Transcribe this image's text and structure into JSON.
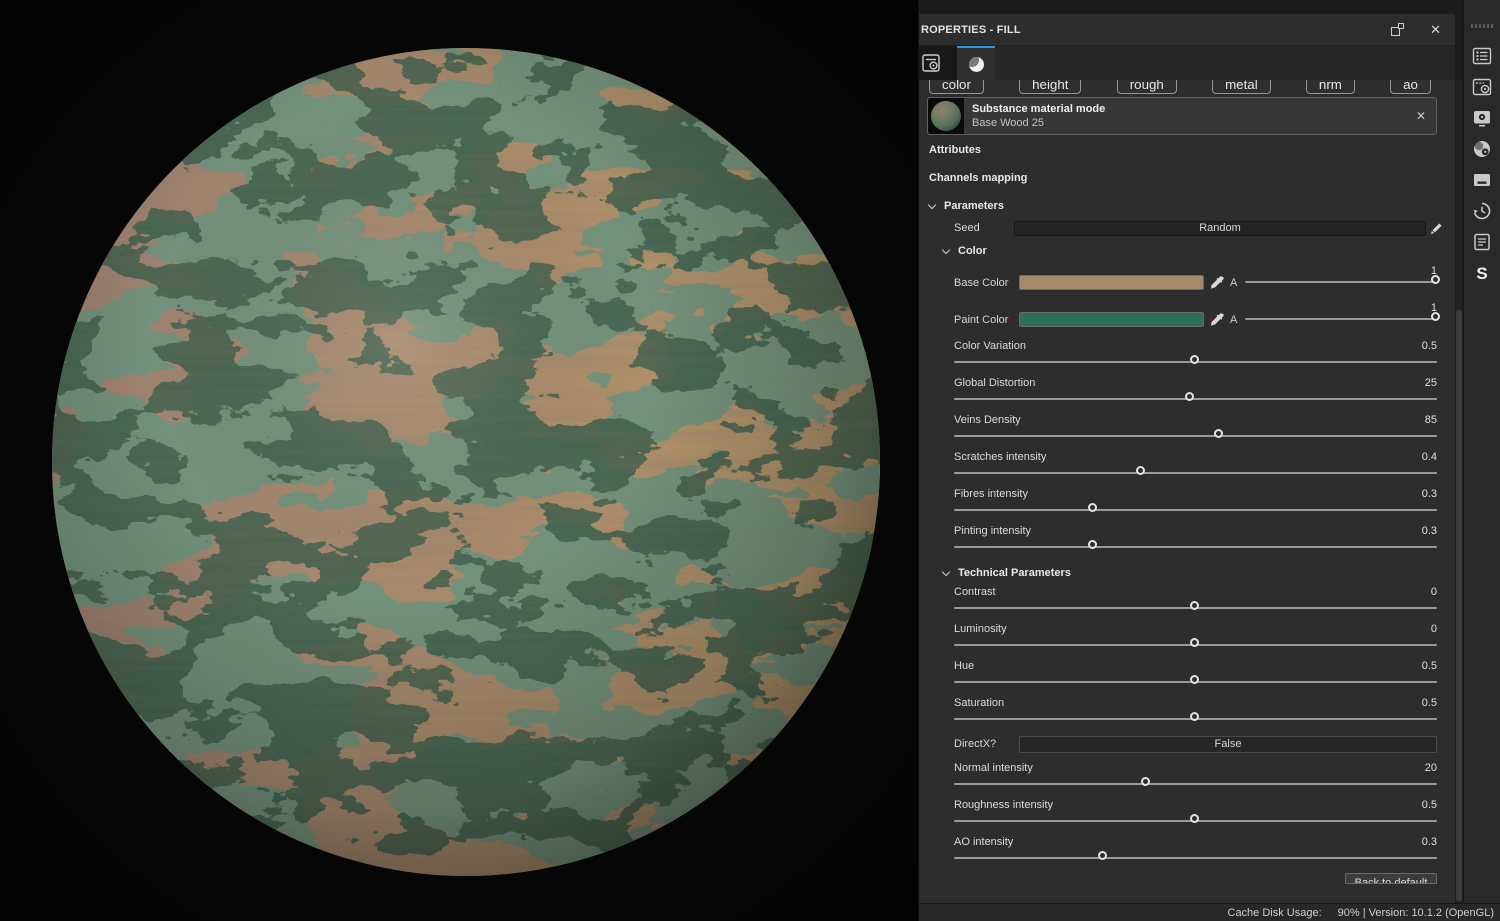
{
  "panel": {
    "title": "ROPERTIES - FILL",
    "close_glyph": "✕",
    "channels": [
      "color",
      "height",
      "rough",
      "metal",
      "nrm",
      "ao"
    ],
    "material": {
      "mode": "Substance material mode",
      "name": "Base Wood 25",
      "close_glyph": "✕"
    },
    "sections": {
      "attributes": "Attributes",
      "channels_mapping": "Channels mapping",
      "parameters": "Parameters",
      "color": "Color",
      "technical": "Technical Parameters"
    },
    "seed": {
      "label": "Seed",
      "value": "Random"
    },
    "color_rows": [
      {
        "label": "Base Color",
        "color": "#a58a6c",
        "alpha": "A",
        "value": "1",
        "percent": 100
      },
      {
        "label": "Paint Color",
        "color": "#2f6f56",
        "alpha": "A",
        "value": "1",
        "percent": 100
      }
    ],
    "sliders": [
      {
        "label": "Color Variation",
        "value": "0.5",
        "percent": 50
      },
      {
        "label": "Global Distortion",
        "value": "25",
        "percent": 49
      },
      {
        "label": "Veins Density",
        "value": "85",
        "percent": 55
      },
      {
        "label": "Scratches intensity",
        "value": "0.4",
        "percent": 39
      },
      {
        "label": "Fibres intensity",
        "value": "0.3",
        "percent": 29
      },
      {
        "label": "Pinting intensity",
        "value": "0.3",
        "percent": 29
      },
      {
        "label": "Contrast",
        "value": "0",
        "percent": 50
      },
      {
        "label": "Luminosity",
        "value": "0",
        "percent": 50
      },
      {
        "label": "Hue",
        "value": "0.5",
        "percent": 50
      },
      {
        "label": "Saturation",
        "value": "0.5",
        "percent": 50
      },
      {
        "label": "Normal intensity",
        "value": "20",
        "percent": 40
      },
      {
        "label": "Roughness intensity",
        "value": "0.5",
        "percent": 50
      },
      {
        "label": "AO intensity",
        "value": "0.3",
        "percent": 31
      }
    ],
    "directx": {
      "label": "DirectX?",
      "value": "False"
    },
    "reset_button": "Back to default values"
  },
  "status": {
    "left": "Cache Disk Usage:",
    "right": "90% | Version: 10.1.2 (OpenGL)"
  },
  "toolbar": {
    "logo": "S"
  },
  "colors": {
    "accent": "#2e8fe8",
    "base_color": "#a58a6c",
    "paint_color": "#2f6f56"
  }
}
